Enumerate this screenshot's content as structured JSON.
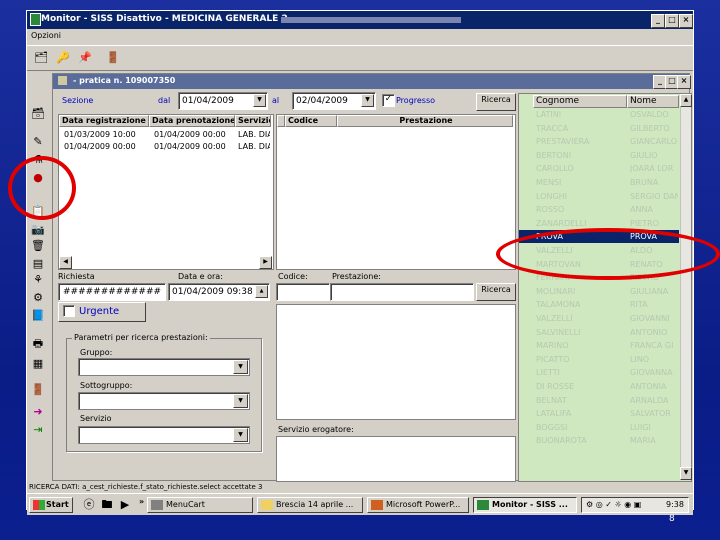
{
  "window": {
    "title": "Monitor - SISS Disattivo - MEDICINA GENERALE 2 -",
    "min": "_",
    "max": "□",
    "close": "×"
  },
  "menu": {
    "options": "Opzioni"
  },
  "child": {
    "title": "- pratica n. 109007350"
  },
  "filter": {
    "section_label": "Sezione",
    "from_label": "dal",
    "from_value": "01/04/2009",
    "to_label": "al",
    "to_value": "02/04/2009",
    "progress_label": "Progresso",
    "search_label": "Ricerca"
  },
  "requests_table": {
    "columns": [
      "Data registrazione",
      "Data prenotazione",
      "Servizio"
    ],
    "rows": [
      [
        "01/03/2009 10:00",
        "01/04/2009 00:00",
        "LAB. DIA"
      ],
      [
        "01/04/2009 00:00",
        "01/04/2009 00:00",
        "LAB. DIA"
      ]
    ]
  },
  "prestazioni_table": {
    "columns": [
      "Codice",
      "Prestazione"
    ]
  },
  "lower_left": {
    "request_label": "Richiesta",
    "date_label": "Data e ora:",
    "request_value": "#############",
    "date_value": "01/04/2009 09:38",
    "urgent_label": "Urgente"
  },
  "lower_mid": {
    "code_label": "Codice:",
    "prestazione_label": "Prestazione:",
    "search_label": "Ricerca",
    "service_provider_label": "Servizio erogatore:"
  },
  "group": {
    "title": "Parametri per ricerca prestazioni:",
    "gruppo": "Gruppo:",
    "sottogruppo": "Sottogruppo:",
    "servizio": "Servizio"
  },
  "patients": {
    "columns": [
      "Cognome",
      "Nome"
    ],
    "rows": [
      [
        "LATINI",
        "OSVALDO"
      ],
      [
        "TRACCA",
        "GILBERTO"
      ],
      [
        "PRESTAVIERA",
        "GIANCARLO"
      ],
      [
        "BERTONI",
        "GIULIO"
      ],
      [
        "CAROLLO",
        "JOARA LOR"
      ],
      [
        "MENSI",
        "BRUNA"
      ],
      [
        "LONGHI",
        "SERGIO DAN"
      ],
      [
        "ROSSO",
        "ANNA"
      ],
      [
        "ZANARDELLI",
        "PIETRO"
      ],
      [
        "PROVA",
        "PROVA"
      ],
      [
        "VALZELLI",
        "ALDO"
      ],
      [
        "MARTOVAN",
        "RENATO"
      ],
      [
        "FERRARI",
        "PIETRO"
      ],
      [
        "MOLINARI",
        "GIULIANA"
      ],
      [
        "TALAMONA",
        "RITA"
      ],
      [
        "VALZELLI",
        "GIOVANNI"
      ],
      [
        "SALVINELLI",
        "ANTONIO"
      ],
      [
        "MARINO",
        "FRANCA GI"
      ],
      [
        "PICATTO",
        "LINO"
      ],
      [
        "LIETTI",
        "GIOVANNA"
      ],
      [
        "DI ROSSE",
        "ANTONIA"
      ],
      [
        "BELNAT",
        "ARNALDA"
      ],
      [
        "LATALIFA",
        "SALVATOR"
      ],
      [
        "BOGGSI",
        "LUIGI"
      ],
      [
        "BUONAROTA",
        "MARIA"
      ]
    ],
    "selected_index": 9
  },
  "status": {
    "text": "RICERCA DATI: a_cest_richieste.f_stato_richieste.select accettate 3"
  },
  "taskbar": {
    "start": "Start",
    "tasks": [
      "MenuCart",
      "Brescia 14 aprile ...",
      "Microsoft PowerP...",
      "Monitor - SISS ..."
    ],
    "clock": "9:38"
  },
  "slide_number": "8"
}
